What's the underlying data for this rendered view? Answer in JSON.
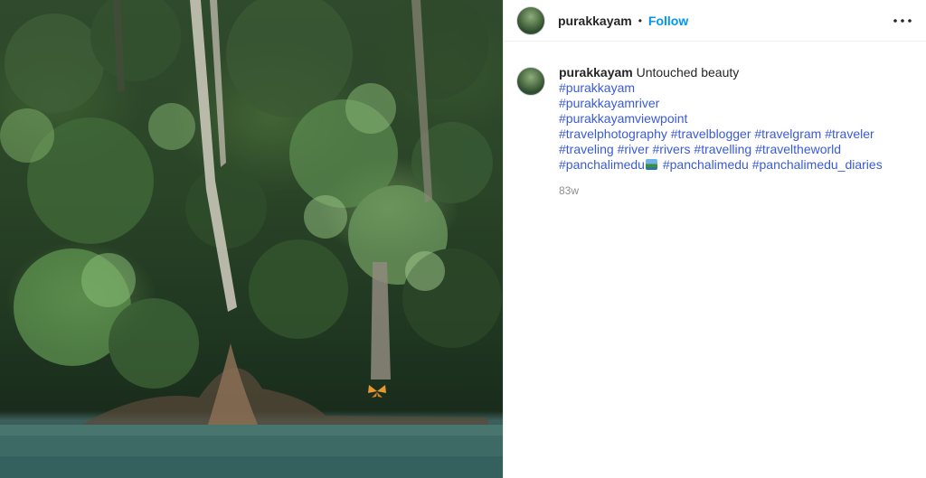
{
  "post": {
    "username": "purakkayam",
    "follow_label": "Follow",
    "separator": "•",
    "more_icon": "more-horizontal-icon",
    "caption_text": "Untouched beauty",
    "hashtags": {
      "line1": [
        "#purakkayam"
      ],
      "line2": [
        "#purakkayamriver"
      ],
      "line3": [
        "#purakkayamviewpoint"
      ],
      "line4": [
        "#travelphotography",
        "#travelblogger",
        "#travelgram",
        "#traveler"
      ],
      "line5": [
        "#traveling",
        "#river",
        "#rivers",
        "#travelling",
        "#traveltheworld"
      ],
      "line6": [
        "#panchalimedu",
        "#panchalimedu",
        "#panchalimedu_diaries"
      ]
    },
    "timestamp": "83w"
  },
  "colors": {
    "link": "#3a5ad8",
    "follow": "#0095f6",
    "secondary_text": "#8e8e8e"
  }
}
